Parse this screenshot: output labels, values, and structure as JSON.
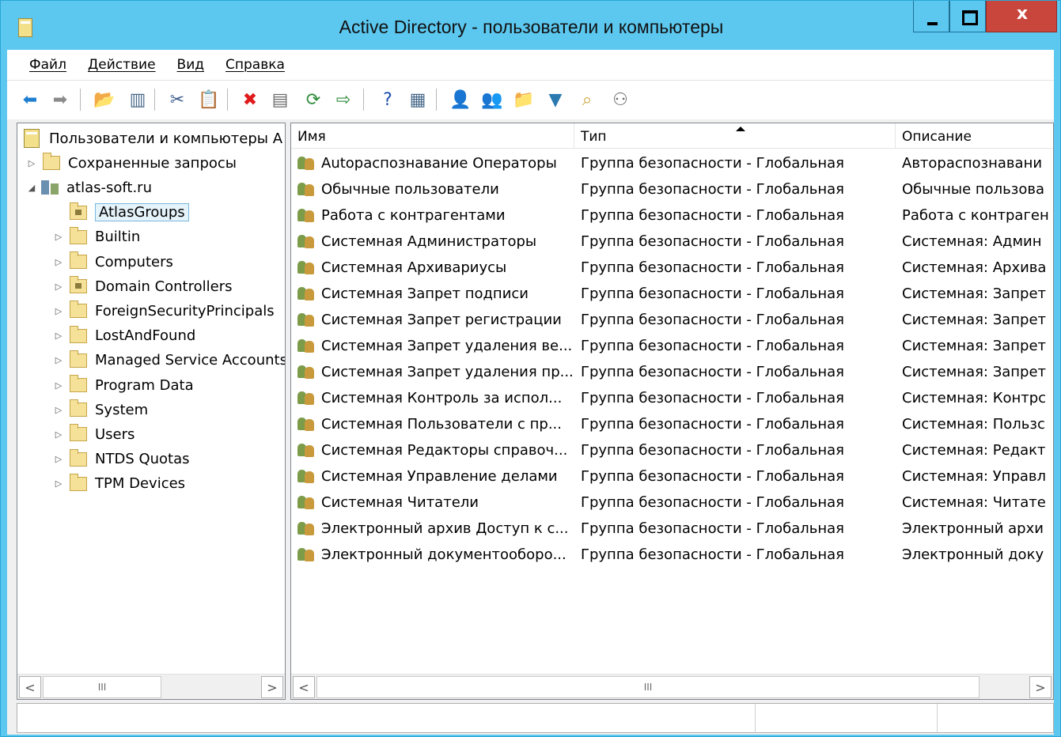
{
  "window": {
    "title": "Active Directory - пользователи и компьютеры"
  },
  "menu": [
    "Файл",
    "Действие",
    "Вид",
    "Справка"
  ],
  "toolbar": [
    {
      "icon": "back-arrow-icon",
      "glyph": "⬅",
      "color": "#1e7fd0"
    },
    {
      "icon": "forward-arrow-icon",
      "glyph": "➡",
      "color": "#8a8a8a"
    },
    {
      "icon": "up-folder-icon",
      "glyph": "📂",
      "color": "#caa636"
    },
    {
      "icon": "show-console-tree-icon",
      "glyph": "▥",
      "color": "#4a6a8a"
    },
    {
      "icon": "cut-icon",
      "glyph": "✂",
      "color": "#3a5a8a"
    },
    {
      "icon": "paste-icon",
      "glyph": "📋",
      "color": "#4a4a4a"
    },
    {
      "icon": "delete-icon",
      "glyph": "✖",
      "color": "#e01a1a"
    },
    {
      "icon": "properties-icon",
      "glyph": "▤",
      "color": "#6a6a6a"
    },
    {
      "icon": "refresh-icon",
      "glyph": "⟳",
      "color": "#2e8b3a"
    },
    {
      "icon": "export-list-icon",
      "glyph": "⇨",
      "color": "#2e8b3a"
    },
    {
      "icon": "help-icon",
      "glyph": "?",
      "color": "#1e4fb0"
    },
    {
      "icon": "action-pane-icon",
      "glyph": "▦",
      "color": "#4a6a8a"
    },
    {
      "icon": "new-user-icon",
      "glyph": "👤",
      "color": "#3a6ab0"
    },
    {
      "icon": "new-group-icon",
      "glyph": "👥",
      "color": "#c89a3c"
    },
    {
      "icon": "new-ou-icon",
      "glyph": "📁",
      "color": "#caa636"
    },
    {
      "icon": "filter-icon",
      "glyph": "▼",
      "color": "#2a7ab0"
    },
    {
      "icon": "find-icon",
      "glyph": "⌕",
      "color": "#caa636"
    },
    {
      "icon": "add-to-group-icon",
      "glyph": "⚇",
      "color": "#6a6a6a"
    }
  ],
  "tree": [
    {
      "label": "Пользователи и компьютеры А",
      "level": 0,
      "icon": "root",
      "arrow": ""
    },
    {
      "label": "Сохраненные запросы",
      "level": 1,
      "icon": "folder",
      "arrow": "▷"
    },
    {
      "label": "atlas-soft.ru",
      "level": 1,
      "icon": "domain",
      "arrow": "◢"
    },
    {
      "label": "AtlasGroups",
      "level": 2,
      "icon": "folder-special",
      "arrow": "",
      "selected": true
    },
    {
      "label": "Builtin",
      "level": 2,
      "icon": "folder",
      "arrow": "▷"
    },
    {
      "label": "Computers",
      "level": 2,
      "icon": "folder",
      "arrow": "▷"
    },
    {
      "label": "Domain Controllers",
      "level": 2,
      "icon": "folder-special",
      "arrow": "▷"
    },
    {
      "label": "ForeignSecurityPrincipals",
      "level": 2,
      "icon": "folder",
      "arrow": "▷"
    },
    {
      "label": "LostAndFound",
      "level": 2,
      "icon": "folder",
      "arrow": "▷"
    },
    {
      "label": "Managed Service Accounts",
      "level": 2,
      "icon": "folder",
      "arrow": "▷"
    },
    {
      "label": "Program Data",
      "level": 2,
      "icon": "folder",
      "arrow": "▷"
    },
    {
      "label": "System",
      "level": 2,
      "icon": "folder",
      "arrow": "▷"
    },
    {
      "label": "Users",
      "level": 2,
      "icon": "folder",
      "arrow": "▷"
    },
    {
      "label": "NTDS Quotas",
      "level": 2,
      "icon": "folder",
      "arrow": "▷"
    },
    {
      "label": "TPM Devices",
      "level": 2,
      "icon": "folder",
      "arrow": "▷"
    }
  ],
  "list": {
    "columns": [
      "Имя",
      "Тип",
      "Описание"
    ],
    "rows": [
      {
        "name": "Autoраспознавание Операторы",
        "type": "Группа безопасности - Глобальная",
        "desc": "Автораспознавани"
      },
      {
        "name": "Обычные пользователи",
        "type": "Группа безопасности - Глобальная",
        "desc": "Обычные пользова"
      },
      {
        "name": "Работа с контрагентами",
        "type": "Группа безопасности - Глобальная",
        "desc": "Работа с контраген"
      },
      {
        "name": "Системная Администраторы",
        "type": "Группа безопасности - Глобальная",
        "desc": "Системная: Админ"
      },
      {
        "name": "Системная Архивариусы",
        "type": "Группа безопасности - Глобальная",
        "desc": "Системная: Архива"
      },
      {
        "name": "Системная Запрет подписи",
        "type": "Группа безопасности - Глобальная",
        "desc": "Системная: Запрет"
      },
      {
        "name": "Системная Запрет регистрации",
        "type": "Группа безопасности - Глобальная",
        "desc": "Системная: Запрет"
      },
      {
        "name": "Системная Запрет удаления ве...",
        "type": "Группа безопасности - Глобальная",
        "desc": "Системная: Запрет"
      },
      {
        "name": "Системная Запрет удаления пр...",
        "type": "Группа безопасности - Глобальная",
        "desc": "Системная: Запрет"
      },
      {
        "name": "Системная Контроль за испол...",
        "type": "Группа безопасности - Глобальная",
        "desc": "Системная: Контрс"
      },
      {
        "name": "Системная Пользователи с пр...",
        "type": "Группа безопасности - Глобальная",
        "desc": "Системная: Пользс"
      },
      {
        "name": "Системная Редакторы справоч...",
        "type": "Группа безопасности - Глобальная",
        "desc": "Системная: Редакт"
      },
      {
        "name": "Системная Управление делами",
        "type": "Группа безопасности - Глобальная",
        "desc": "Системная: Управл"
      },
      {
        "name": "Системная Читатели",
        "type": "Группа безопасности - Глобальная",
        "desc": "Системная: Читате"
      },
      {
        "name": "Электронный архив Доступ к с...",
        "type": "Группа безопасности - Глобальная",
        "desc": "Электронный архи"
      },
      {
        "name": "Электронный документооборо...",
        "type": "Группа безопасности - Глобальная",
        "desc": "Электронный доку"
      }
    ]
  },
  "scroll": {
    "left": "<",
    "right": ">",
    "grip": "III"
  }
}
